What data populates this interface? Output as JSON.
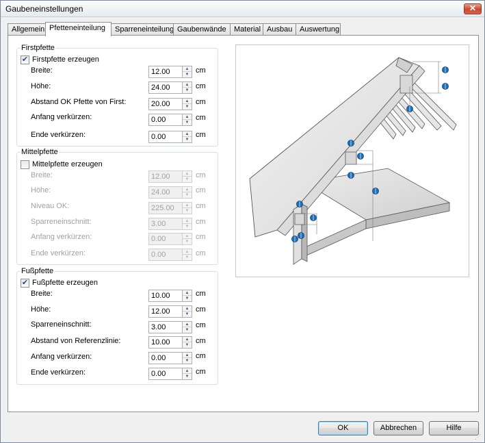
{
  "window": {
    "title": "Gaubeneinstellungen",
    "close_label": "✕"
  },
  "tabs": [
    {
      "label": "Allgemein"
    },
    {
      "label": "Pfetteneinteilung"
    },
    {
      "label": "Sparreneinteilung"
    },
    {
      "label": "Gaubenwände"
    },
    {
      "label": "Material"
    },
    {
      "label": "Ausbau"
    },
    {
      "label": "Auswertung"
    }
  ],
  "firstpfette": {
    "group_label": "Firstpfette",
    "checkbox_label": "Firstpfette erzeugen",
    "checked": true,
    "fields": [
      {
        "label": "Breite:",
        "value": "12.00",
        "unit": "cm"
      },
      {
        "label": "Höhe:",
        "value": "24.00",
        "unit": "cm"
      },
      {
        "label": "Abstand OK Pfette von First:",
        "value": "20.00",
        "unit": "cm"
      },
      {
        "label": "Anfang verkürzen:",
        "value": "0.00",
        "unit": "cm"
      },
      {
        "label": "Ende verkürzen:",
        "value": "0.00",
        "unit": "cm"
      }
    ]
  },
  "mittelpfette": {
    "group_label": "Mittelpfette",
    "checkbox_label": "Mittelpfette erzeugen",
    "checked": false,
    "fields": [
      {
        "label": "Breite:",
        "value": "12.00",
        "unit": "cm"
      },
      {
        "label": "Höhe:",
        "value": "24.00",
        "unit": "cm"
      },
      {
        "label": "Niveau OK:",
        "value": "225.00",
        "unit": "cm"
      },
      {
        "label": "Sparreneinschnitt:",
        "value": "3.00",
        "unit": "cm"
      },
      {
        "label": "Anfang verkürzen:",
        "value": "0.00",
        "unit": "cm"
      },
      {
        "label": "Ende verkürzen:",
        "value": "0.00",
        "unit": "cm"
      }
    ]
  },
  "fusspfette": {
    "group_label": "Fußpfette",
    "checkbox_label": "Fußpfette erzeugen",
    "checked": true,
    "fields": [
      {
        "label": "Breite:",
        "value": "10.00",
        "unit": "cm"
      },
      {
        "label": "Höhe:",
        "value": "12.00",
        "unit": "cm"
      },
      {
        "label": "Sparreneinschnitt:",
        "value": "3.00",
        "unit": "cm"
      },
      {
        "label": "Abstand von Referenzlinie:",
        "value": "10.00",
        "unit": "cm"
      },
      {
        "label": "Anfang verkürzen:",
        "value": "0.00",
        "unit": "cm"
      },
      {
        "label": "Ende verkürzen:",
        "value": "0.00",
        "unit": "cm"
      }
    ]
  },
  "buttons": {
    "ok": "OK",
    "cancel": "Abbrechen",
    "help": "Hilfe"
  },
  "colors": {
    "handle": "#1f6fb8",
    "roof": "#e4e4e4",
    "accent": "#3c7fb1"
  }
}
